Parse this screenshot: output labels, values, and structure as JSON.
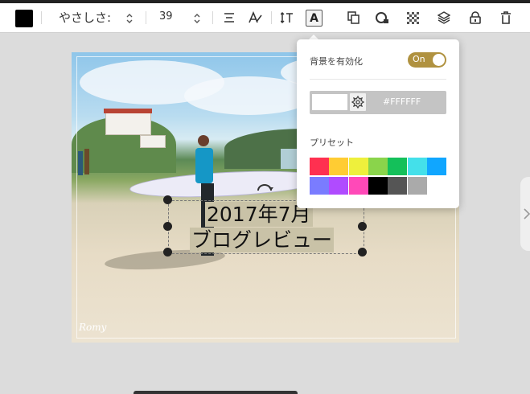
{
  "toolbar": {
    "text_color": "#000000",
    "font_name": "やさしさ:",
    "font_size": "39",
    "align_icon": "align-center-icon",
    "style_icon": "text-style-icon",
    "spacing_icon": "line-spacing-icon",
    "background_icon": "text-background-icon",
    "background_glyph": "A",
    "duplicate_icon": "duplicate-icon",
    "shape_icon": "shape-icon",
    "transparency_icon": "transparency-icon",
    "layers_icon": "layers-icon",
    "lock_icon": "lock-icon",
    "delete_icon": "trash-icon"
  },
  "canvas": {
    "text_line_1": "2017年7月",
    "text_line_2": "ブログレビュー",
    "watermark": "Romy"
  },
  "popup": {
    "enable_label": "背景を有効化",
    "toggle_state": "On",
    "hex_value": "#FFFFFF",
    "preview_color": "#FFFFFF",
    "presets_label": "プリセット",
    "presets": [
      "#ff3050",
      "#ffcc33",
      "#eef03c",
      "#8ad44b",
      "#14c05a",
      "#44e0ea",
      "#10a6ff",
      "#7a7cff",
      "#b04bff",
      "#ff49b8",
      "#000000",
      "#555555",
      "#aaaaaa",
      "#ffffff"
    ]
  }
}
